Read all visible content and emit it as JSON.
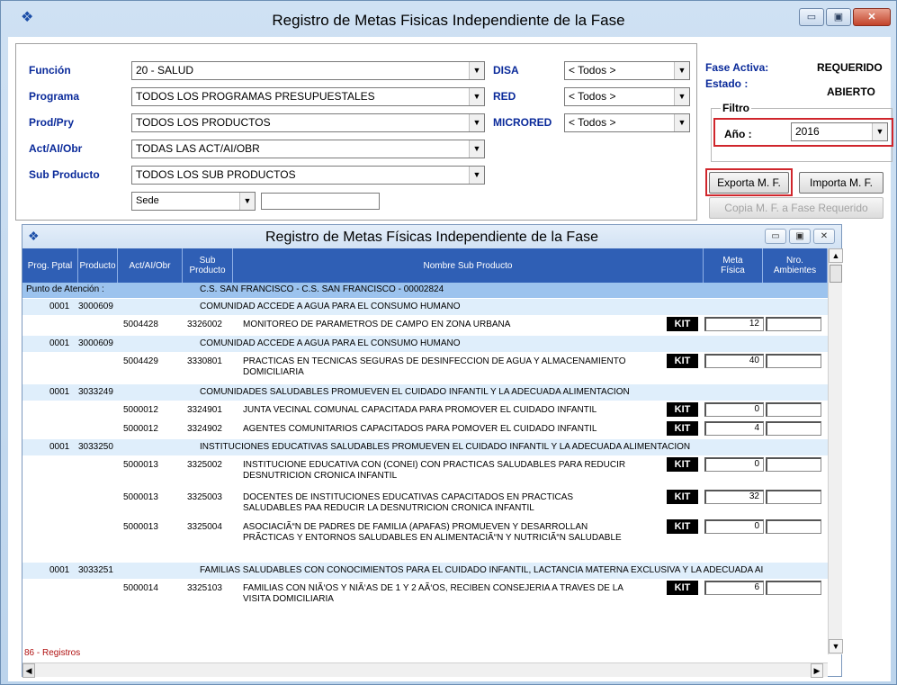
{
  "window": {
    "title": "Registro de Metas Fisicas Independiente de la Fase",
    "min_label": "▭",
    "max_label": "▣",
    "close_label": "✕"
  },
  "filters": {
    "funcion": {
      "label": "Función",
      "value": "20 - SALUD"
    },
    "programa": {
      "label": "Programa",
      "value": "TODOS LOS PROGRAMAS PRESUPUESTALES"
    },
    "prodpry": {
      "label": "Prod/Pry",
      "value": "TODOS LOS PRODUCTOS"
    },
    "actaiobr": {
      "label": "Act/AI/Obr",
      "value": "TODAS LAS ACT/AI/OBR"
    },
    "subproducto": {
      "label": "Sub Producto",
      "value": "TODOS LOS SUB PRODUCTOS"
    },
    "sede": {
      "value": "Sede"
    },
    "disa": {
      "label": "DISA",
      "value": "< Todos >"
    },
    "red": {
      "label": "RED",
      "value": "< Todos >"
    },
    "microred": {
      "label": "MICRORED",
      "value": "< Todos >"
    }
  },
  "status": {
    "fase_label": "Fase Activa:",
    "fase_value": "REQUERIDO",
    "estado_label": "Estado :",
    "estado_value": "ABIERTO",
    "filtro_legend": "Filtro",
    "anio_label": "Año :",
    "anio_value": "2016"
  },
  "buttons": {
    "exporta": "Exporta M. F.",
    "importa": "Importa M. F.",
    "copia": "Copia M. F. a Fase Requerido"
  },
  "inner": {
    "title": "Registro de Metas Físicas Independiente de la Fase",
    "min_label": "▭",
    "max_label": "▣",
    "close_label": "✕"
  },
  "grid": {
    "headers": {
      "prog": "Prog. Pptal",
      "producto": "Producto",
      "act": "Act/AI/Obr",
      "sub": "Sub Producto",
      "nombre": "Nombre Sub Producto",
      "meta": "Meta Física",
      "amb": "Nro. Ambientes"
    },
    "attention": {
      "label": "Punto de Atención :",
      "value": "C.S. SAN FRANCISCO - C.S. SAN FRANCISCO - 00002824"
    },
    "groups": [
      {
        "prog": "0001",
        "prod": "3000609",
        "name": "COMUNIDAD ACCEDE A AGUA PARA EL CONSUMO HUMANO"
      },
      {
        "prog": "0001",
        "prod": "3000609",
        "name": "COMUNIDAD ACCEDE A AGUA PARA EL CONSUMO HUMANO"
      },
      {
        "prog": "0001",
        "prod": "3033249",
        "name": "COMUNIDADES SALUDABLES PROMUEVEN EL CUIDADO INFANTIL Y LA ADECUADA ALIMENTACION"
      },
      {
        "prog": "0001",
        "prod": "3033250",
        "name": "INSTITUCIONES EDUCATIVAS SALUDABLES PROMUEVEN EL CUIDADO INFANTIL Y LA ADECUADA ALIMENTACION"
      },
      {
        "prog": "0001",
        "prod": "3033251",
        "name": "FAMILIAS SALUDABLES CON CONOCIMIENTOS PARA EL CUIDADO INFANTIL, LACTANCIA MATERNA EXCLUSIVA Y LA ADECUADA AI"
      }
    ],
    "items": [
      {
        "act": "5004428",
        "sub": "3326002",
        "name": "MONITOREO DE PARAMETROS DE CAMPO EN ZONA URBANA",
        "kit": "KIT",
        "meta": "12"
      },
      {
        "act": "5004429",
        "sub": "3330801",
        "name": "PRACTICAS EN TECNICAS SEGURAS DE DESINFECCION DE AGUA Y ALMACENAMIENTO DOMICILIARIA",
        "kit": "KIT",
        "meta": "40"
      },
      {
        "act": "5000012",
        "sub": "3324901",
        "name": "JUNTA VECINAL COMUNAL CAPACITADA PARA PROMOVER EL CUIDADO INFANTIL",
        "kit": "KIT",
        "meta": "0"
      },
      {
        "act": "5000012",
        "sub": "3324902",
        "name": "AGENTES COMUNITARIOS CAPACITADOS PARA POMOVER EL CUIDADO INFANTIL",
        "kit": "KIT",
        "meta": "4"
      },
      {
        "act": "5000013",
        "sub": "3325002",
        "name": "INSTITUCIONE EDUCATIVA CON (CONEI) CON PRACTICAS SALUDABLES PARA REDUCIR DESNUTRICION CRONICA INFANTIL",
        "kit": "KIT",
        "meta": "0"
      },
      {
        "act": "5000013",
        "sub": "3325003",
        "name": "DOCENTES DE INSTITUCIONES EDUCATIVAS CAPACITADOS EN PRACTICAS SALUDABLES PAA REDUCIR LA DESNUTRICION CRONICA INFANTIL",
        "kit": "KIT",
        "meta": "32"
      },
      {
        "act": "5000013",
        "sub": "3325004",
        "name": "ASOCIACIÃ“N DE PADRES DE FAMILIA (APAFAS) PROMUEVEN Y DESARROLLAN PRÃCTICAS Y ENTORNOS SALUDABLES EN ALIMENTACIÃ“N Y NUTRICIÃ“N SALUDABLE",
        "kit": "KIT",
        "meta": "0"
      },
      {
        "act": "5000014",
        "sub": "3325103",
        "name": "FAMILIAS CON NIÃ‘OS Y NIÃ‘AS DE 1 Y 2 AÃ‘OS, RECIBEN CONSEJERIA A TRAVES DE LA VISITA DOMICILIARIA",
        "kit": "KIT",
        "meta": "6"
      }
    ],
    "registros": "86 - Registros"
  }
}
